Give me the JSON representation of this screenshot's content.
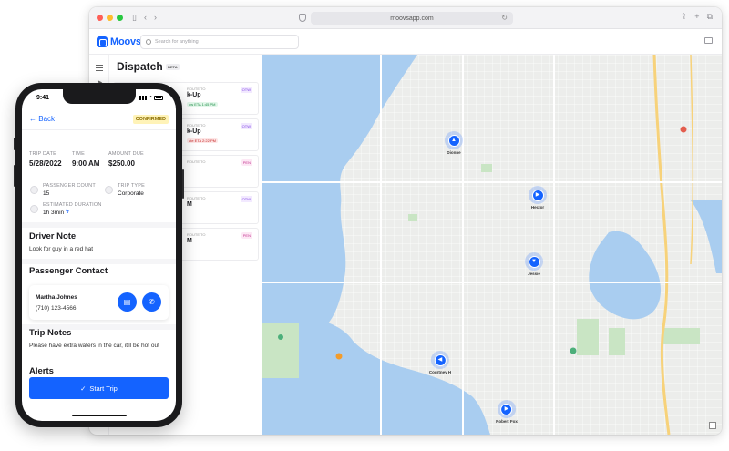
{
  "browser": {
    "url": "moovsapp.com"
  },
  "app": {
    "brand": "Moovs",
    "search_placeholder": "Search for anything",
    "page_title": "Dispatch",
    "beta_badge": "BETA"
  },
  "trip_cards": [
    {
      "sub": "ROUTE TO",
      "title": "k-Up",
      "tag": "ow ETA 1:45 PM",
      "status": "OTW",
      "tag_color": "green",
      "status_color": "otw",
      "bar": "#1463ff"
    },
    {
      "sub": "ROUTE TO",
      "title": "k-Up",
      "tag": "ate ETA 2:22 PM",
      "status": "OTW",
      "tag_color": "red",
      "status_color": "otw",
      "bar": "#e53935"
    },
    {
      "sub": "ROUTE TO",
      "title": "",
      "tag": "",
      "status": "PEN",
      "tag_color": "yellow",
      "status_color": "pending",
      "bar": "#f6b800"
    },
    {
      "sub": "ROUTE TO",
      "title": "M",
      "tag": "",
      "status": "OTW",
      "tag_color": "green",
      "status_color": "otw",
      "bar": "#1463ff"
    },
    {
      "sub": "ROUTE TO",
      "title": "M",
      "tag": "",
      "status": "PEN",
      "tag_color": "yellow",
      "status_color": "pending",
      "bar": "#f6b800"
    }
  ],
  "drivers": [
    {
      "name": "Dionne"
    },
    {
      "name": "Hector"
    },
    {
      "name": "Jessie"
    },
    {
      "name": "Courtney H"
    },
    {
      "name": "Robert Fox"
    }
  ],
  "phone": {
    "time": "9:41",
    "back_label": "Back",
    "status": "CONFIRMED",
    "trip_date_label": "TRIP DATE",
    "trip_date": "5/28/2022",
    "time_label": "TIME",
    "time_value": "9:00 AM",
    "amount_label": "AMOUNT DUE",
    "amount": "$250.00",
    "passenger_count_label": "PASSENGER COUNT",
    "passenger_count": "15",
    "trip_type_label": "TRIP TYPE",
    "trip_type": "Corporate",
    "duration_label": "ESTIMATED DURATION",
    "duration": "1h 3min",
    "driver_note_title": "Driver Note",
    "driver_note": "Look for guy in a red hat",
    "contact_title": "Passenger Contact",
    "contact_name": "Martha Johnes",
    "contact_phone": "(710) 123-4566",
    "trip_notes_title": "Trip Notes",
    "trip_notes": "Please have extra waters in the car, it'll be hot out",
    "alerts_title": "Alerts",
    "start_button": "Start Trip"
  },
  "colors": {
    "accent": "#1463ff",
    "confirmed_bg": "#fff3b8",
    "water": "#a9cdf0",
    "park": "#c9e5c4",
    "highway": "#f7d27a"
  }
}
